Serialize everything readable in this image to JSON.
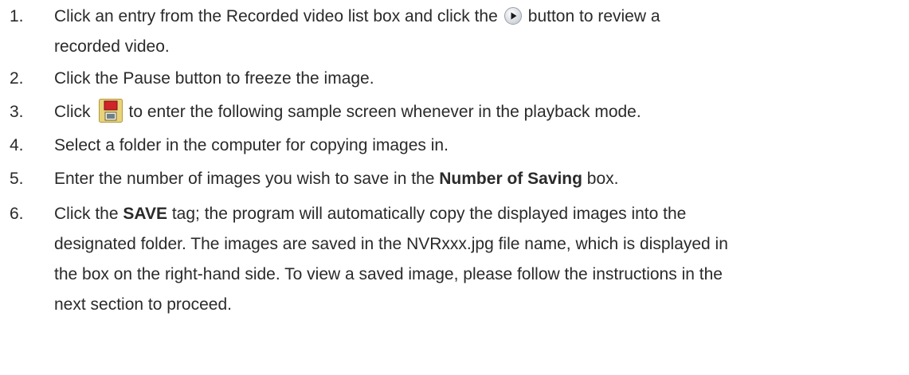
{
  "steps": [
    {
      "number": "1.",
      "line1_before": "Click an entry from the Recorded video list box and click the",
      "icon": "play-button-icon",
      "line1_after": "button to review a",
      "line2": "recorded video."
    },
    {
      "number": "2.",
      "text": "Click the Pause button to freeze the image."
    },
    {
      "number": "3.",
      "before": "Click",
      "icon": "save-floppy-icon",
      "after": "to enter the following sample screen whenever in the playback mode."
    },
    {
      "number": "4.",
      "text": "Select a folder in the computer for copying images in."
    },
    {
      "number": "5.",
      "before": "Enter the number of images you wish to save in the ",
      "bold": "Number of Saving",
      "after": " box."
    },
    {
      "number": "6.",
      "before": "Click the ",
      "bold": "SAVE",
      "after": " tag; the program will automatically copy the displayed images into the",
      "line2": "designated folder. The images are saved in the NVRxxx.jpg file name, which is displayed in",
      "line3": "the box on the right-hand side. To view a saved image, please follow the instructions in the",
      "line4": "next section to proceed."
    }
  ],
  "colors": {
    "text": "#2a2a2a",
    "save_icon_body": "#e8d37a",
    "save_icon_label": "#d0242a"
  }
}
